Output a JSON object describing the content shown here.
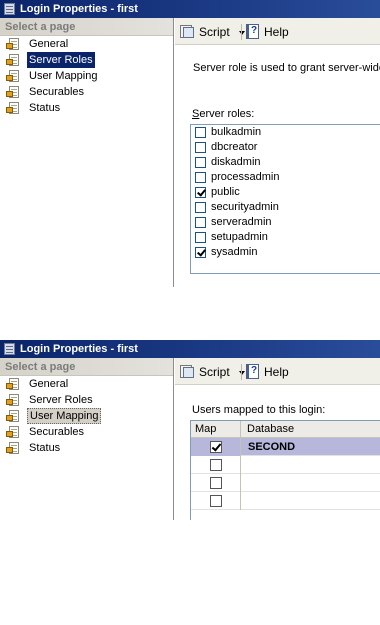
{
  "window1": {
    "title": "Login Properties - first",
    "select_page_header": "Select a page",
    "pages": [
      {
        "label": "General",
        "state": "normal"
      },
      {
        "label": "Server Roles",
        "state": "selected"
      },
      {
        "label": "User Mapping",
        "state": "normal"
      },
      {
        "label": "Securables",
        "state": "normal"
      },
      {
        "label": "Status",
        "state": "normal"
      }
    ],
    "toolbar": {
      "script_label": "Script",
      "help_label": "Help"
    },
    "description": "Server role is used to grant server-wide",
    "roles_label": "Server roles:",
    "roles": [
      {
        "name": "bulkadmin",
        "checked": false
      },
      {
        "name": "dbcreator",
        "checked": false
      },
      {
        "name": "diskadmin",
        "checked": false
      },
      {
        "name": "processadmin",
        "checked": false
      },
      {
        "name": "public",
        "checked": true
      },
      {
        "name": "securityadmin",
        "checked": false
      },
      {
        "name": "serveradmin",
        "checked": false
      },
      {
        "name": "setupadmin",
        "checked": false
      },
      {
        "name": "sysadmin",
        "checked": true
      }
    ]
  },
  "window2": {
    "title": "Login Properties - first",
    "select_page_header": "Select a page",
    "pages": [
      {
        "label": "General",
        "state": "normal"
      },
      {
        "label": "Server Roles",
        "state": "normal"
      },
      {
        "label": "User Mapping",
        "state": "selected"
      },
      {
        "label": "Securables",
        "state": "normal"
      },
      {
        "label": "Status",
        "state": "normal"
      }
    ],
    "toolbar": {
      "script_label": "Script",
      "help_label": "Help"
    },
    "users_label": "Users mapped to this login:",
    "grid": {
      "col_map": "Map",
      "col_database": "Database",
      "rows": [
        {
          "map": true,
          "database": "SECOND",
          "selected": true
        },
        {
          "map": false,
          "database": "",
          "selected": false
        },
        {
          "map": false,
          "database": "",
          "selected": false
        },
        {
          "map": false,
          "database": "",
          "selected": false
        }
      ]
    }
  }
}
